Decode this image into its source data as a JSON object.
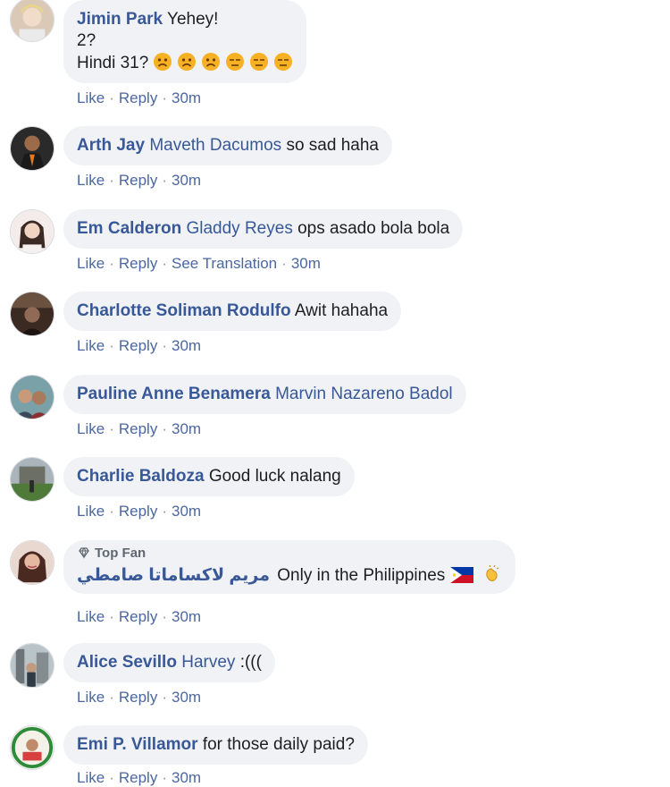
{
  "comments": [
    {
      "author": "Jimin Park",
      "lines": [
        "Yehey!",
        "2?",
        "Hindi 31?"
      ],
      "emojis": [
        "sad-face-icon",
        "sad-face-icon",
        "sad-face-icon",
        "expressionless-face-icon",
        "expressionless-face-icon",
        "expressionless-face-icon"
      ],
      "actions": {
        "like": "Like",
        "reply": "Reply",
        "time": "30m"
      }
    },
    {
      "author": "Arth Jay",
      "tag": "Maveth Dacumos",
      "text": "so sad haha",
      "actions": {
        "like": "Like",
        "reply": "Reply",
        "time": "30m"
      }
    },
    {
      "author": "Em Calderon",
      "tag": "Gladdy Reyes",
      "text": "ops asado bola bola",
      "actions": {
        "like": "Like",
        "reply": "Reply",
        "translate": "See Translation",
        "time": "30m"
      }
    },
    {
      "author": "Charlotte Soliman Rodulfo",
      "text": "Awit hahaha",
      "actions": {
        "like": "Like",
        "reply": "Reply",
        "time": "30m"
      }
    },
    {
      "author": "Pauline Anne Benamera",
      "tag": "Marvin Nazareno Badol",
      "actions": {
        "like": "Like",
        "reply": "Reply",
        "time": "30m"
      }
    },
    {
      "author": "Charlie Baldoza",
      "text": "Good luck nalang",
      "actions": {
        "like": "Like",
        "reply": "Reply",
        "time": "30m"
      }
    },
    {
      "badge": "Top Fan",
      "author": "مريم لاكساماتا صامطي",
      "text": "Only in the Philippines",
      "actions": {
        "like": "Like",
        "reply": "Reply",
        "time": "30m"
      }
    },
    {
      "author": "Alice Sevillo",
      "tag": "Harvey",
      "text": ":(((",
      "actions": {
        "like": "Like",
        "reply": "Reply",
        "time": "30m"
      }
    },
    {
      "author": "Emi P. Villamor",
      "text": "for those daily paid?",
      "actions": {
        "like": "Like",
        "reply": "Reply",
        "time": "30m"
      }
    }
  ],
  "separator": "·",
  "colors": {
    "link": "#385898",
    "bubble": "#f0f2f5",
    "meta": "#90949c",
    "action": "#4b67a1"
  }
}
